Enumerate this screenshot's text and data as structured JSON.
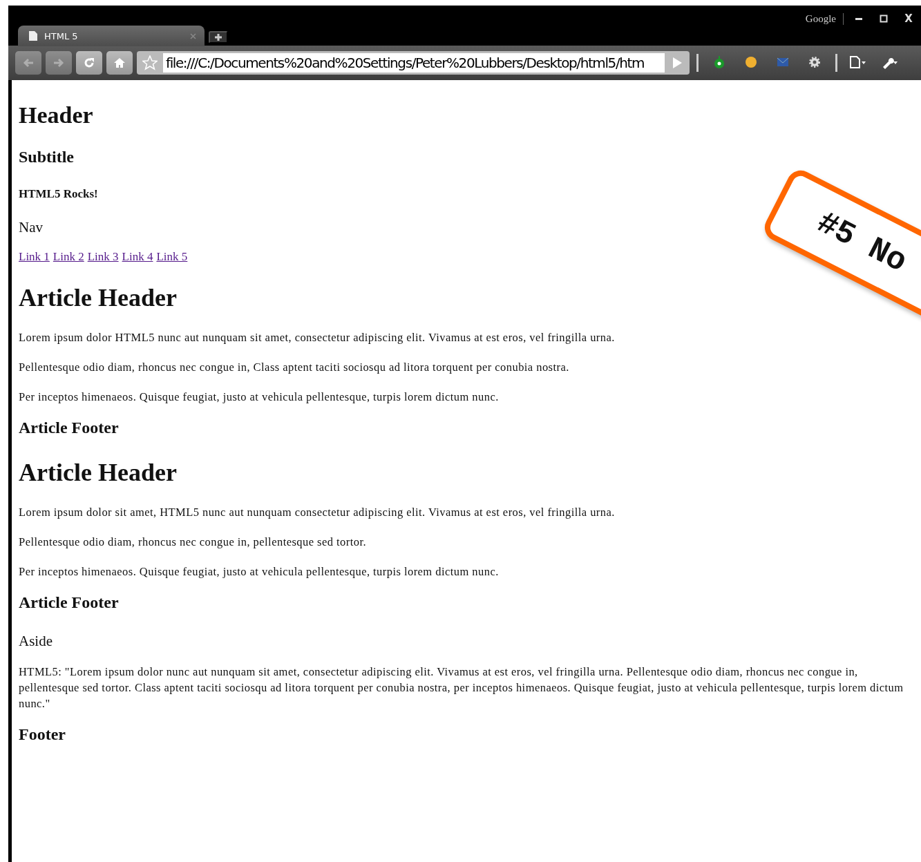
{
  "browser": {
    "brand": "Google",
    "window_controls": [
      {
        "kind": "minimize"
      },
      {
        "kind": "maximize"
      },
      {
        "kind": "close",
        "label": "X"
      }
    ],
    "tabs": [
      {
        "label": "HTML 5",
        "selected": true
      }
    ],
    "address": "file:///C:/Documents%20and%20Settings/Peter%20Lubbers/Desktop/html5/htm",
    "toolbar_buttons": [
      {
        "kind": "back",
        "disabled": true
      },
      {
        "kind": "forward",
        "disabled": true
      },
      {
        "kind": "reload",
        "disabled": false
      },
      {
        "kind": "home",
        "disabled": false
      }
    ],
    "extensions": [
      {
        "kind": "green"
      },
      {
        "kind": "yellow"
      },
      {
        "kind": "mail"
      },
      {
        "kind": "gear"
      },
      {
        "kind": "page"
      },
      {
        "kind": "wrench"
      }
    ]
  },
  "page": [
    {
      "kind": "h1",
      "text": "Header"
    },
    {
      "kind": "h3",
      "text": "Subtitle"
    },
    {
      "kind": "h4",
      "text": "HTML5 Rocks!"
    },
    {
      "kind": "nav",
      "text": "Nav"
    },
    {
      "kind": "links",
      "links": [
        "Link 1",
        "Link 2",
        "Link 3",
        "Link 4",
        "Link 5"
      ]
    },
    {
      "kind": "h2",
      "text": "Article Header"
    },
    {
      "kind": "p",
      "text": "Lorem ipsum dolor HTML5 nunc aut nunquam sit amet, consectetur adipiscing elit. Vivamus at est eros, vel fringilla urna."
    },
    {
      "kind": "p",
      "text": "Pellentesque odio diam, rhoncus nec congue in, Class aptent taciti sociosqu ad litora torquent per conubia nostra."
    },
    {
      "kind": "p",
      "text": "Per inceptos himenaeos. Quisque feugiat, justo at vehicula pellentesque, turpis lorem dictum nunc."
    },
    {
      "kind": "h3",
      "text": "Article Footer"
    },
    {
      "kind": "h2",
      "text": "Article Header"
    },
    {
      "kind": "p",
      "text": "Lorem ipsum dolor sit amet, HTML5 nunc aut nunquam consectetur adipiscing elit. Vivamus at est eros, vel fringilla urna."
    },
    {
      "kind": "p",
      "text": "Pellentesque odio diam, rhoncus nec congue in, pellentesque sed tortor."
    },
    {
      "kind": "p",
      "text": "Per inceptos himenaeos. Quisque feugiat, justo at vehicula pellentesque, turpis lorem dictum nunc."
    },
    {
      "kind": "h3",
      "text": "Article Footer"
    },
    {
      "kind": "nav",
      "text": "Aside"
    },
    {
      "kind": "p",
      "text": "HTML5: \"Lorem ipsum dolor nunc aut nunquam sit amet, consectetur adipiscing elit. Vivamus at est eros, vel fringilla urna. Pellentesque odio diam, rhoncus nec congue in, pellentesque sed tortor. Class aptent taciti sociosqu ad litora torquent per conubia nostra, per inceptos himenaeos. Quisque feugiat, justo at vehicula pellentesque, turpis lorem dictum nunc.\""
    },
    {
      "kind": "h3",
      "text": "Footer"
    }
  ],
  "stamp": "#5 No"
}
